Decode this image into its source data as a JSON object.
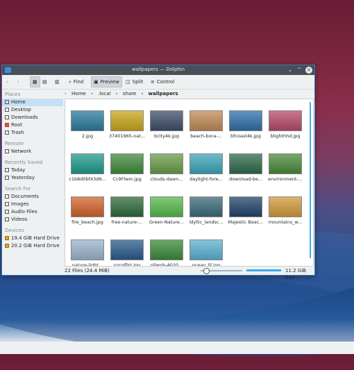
{
  "window": {
    "title": "wallpapers — Dolphin"
  },
  "toolbar": {
    "find": "Find",
    "preview": "Preview",
    "split": "Split",
    "control": "Control"
  },
  "sidebar": {
    "places_header": "Places",
    "places": [
      "Home",
      "Desktop",
      "Downloads",
      "Root",
      "Trash"
    ],
    "remote_header": "Remote",
    "remote": [
      "Network"
    ],
    "recent_header": "Recently Saved",
    "recent": [
      "Today",
      "Yesterday"
    ],
    "search_header": "Search For",
    "search": [
      "Documents",
      "Images",
      "Audio Files",
      "Videos"
    ],
    "devices_header": "Devices",
    "devices": [
      "19.4 GiB Hard Drive",
      "20.2 GiB Hard Drive"
    ]
  },
  "breadcrumb": {
    "items": [
      "Home",
      ".local",
      "share",
      "wallpapers"
    ]
  },
  "files": [
    {
      "name": "2.jpg",
      "color": "#2a7b9c"
    },
    {
      "name": "37401965-nat...",
      "color": "#c8a51c"
    },
    {
      "name": "bclty4k.jpg",
      "color": "#3d4d6a"
    },
    {
      "name": "beach-bora-...",
      "color": "#c08a55"
    },
    {
      "name": "bfcoast4k.jpg",
      "color": "#2f6fa8"
    },
    {
      "name": "blighthhd.jpg",
      "color": "#b54a6a"
    },
    {
      "name": "c1b8d0bf43d9...",
      "color": "#1e9a8a"
    },
    {
      "name": "Cc9Flwm.jpg",
      "color": "#3f8a3a"
    },
    {
      "name": "clouds-dawn...",
      "color": "#6a9a4a"
    },
    {
      "name": "daylight-fore...",
      "color": "#3aa5b8"
    },
    {
      "name": "download-be...",
      "color": "#2e6a4a"
    },
    {
      "name": "environment-...",
      "color": "#4a8a3a"
    },
    {
      "name": "fire_beach.jpg",
      "color": "#d0632a"
    },
    {
      "name": "free-nature-...",
      "color": "#2d6a3a"
    },
    {
      "name": "Green-Nature...",
      "color": "#56b84a"
    },
    {
      "name": "idyllic_landsc...",
      "color": "#3a6a7a"
    },
    {
      "name": "Majestic Beac...",
      "color": "#22446a"
    },
    {
      "name": "mountains_w...",
      "color": "#d09a3a"
    },
    {
      "name": "nature-light...",
      "color": "#9ab4cc"
    },
    {
      "name": "nzcoflirt.jpg",
      "color": "#2a5a8a"
    },
    {
      "name": "nllwnh-4020...",
      "color": "#3a8a3a"
    },
    {
      "name": "ocean_lll.jpg",
      "color": "#5ab0d0"
    }
  ],
  "status": {
    "count": "22 Files (24.4 MiB)",
    "free": "11.2 GiB free"
  }
}
